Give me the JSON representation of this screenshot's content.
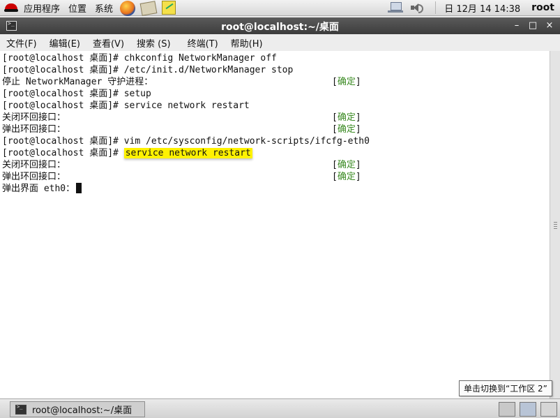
{
  "top_panel": {
    "menus": [
      "应用程序",
      "位置",
      "系统"
    ],
    "launchers": [
      "firefox-icon",
      "mail-icon",
      "notes-icon"
    ],
    "clock": "日 12月 14 14:38",
    "user": "root"
  },
  "window": {
    "title": "root@localhost:~/桌面",
    "controls": [
      "–",
      "□",
      "×"
    ]
  },
  "menubar": [
    "文件(F)",
    "编辑(E)",
    "查看(V)",
    "搜索 (S)",
    "终端(T)",
    "帮助(H)"
  ],
  "terminal": {
    "lines": [
      {
        "text": "[root@localhost 桌面]# chkconfig NetworkManager off",
        "status": ""
      },
      {
        "text": "[root@localhost 桌面]# /etc/init.d/NetworkManager stop",
        "status": ""
      },
      {
        "text": "停止 NetworkManager 守护进程：",
        "status": "确定"
      },
      {
        "text": "[root@localhost 桌面]# setup",
        "status": ""
      },
      {
        "text": "[root@localhost 桌面]# service network restart",
        "status": ""
      },
      {
        "text": "关闭环回接口：",
        "status": "确定"
      },
      {
        "text": "弹出环回接口：",
        "status": "确定"
      },
      {
        "text": "[root@localhost 桌面]# vim /etc/sysconfig/network-scripts/ifcfg-eth0",
        "status": ""
      },
      {
        "prompt": "[root@localhost 桌面]#",
        "command": "service network restart",
        "highlighted": true,
        "status": ""
      },
      {
        "text": "关闭环回接口：",
        "status": "确定"
      },
      {
        "text": "弹出环回接口：",
        "status": "确定"
      },
      {
        "text": "弹出界面 eth0：",
        "status": "",
        "cursor": true
      }
    ]
  },
  "bottom_panel": {
    "task_label": "root@localhost:~/桌面",
    "tooltip": "单击切换到“工作区 2”"
  },
  "colors": {
    "highlight": "#fff200",
    "status_ok": "#3a8a22"
  }
}
